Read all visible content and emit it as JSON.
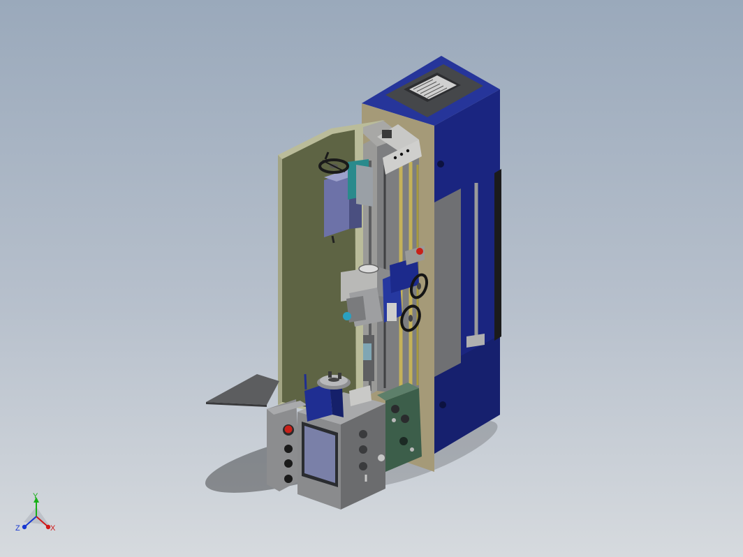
{
  "viewport": {
    "background_top": "#9aa9bb",
    "background_bottom": "#d6dade"
  },
  "model": {
    "accent_blue": "#1c2a8c",
    "panel_olive": "#5e6444",
    "frame_tan": "#a59a78",
    "rail_yellow": "#c4b25a",
    "metal_gray": "#8a8c8e",
    "status_red": "#c82018"
  },
  "triad": {
    "x_label": "X",
    "y_label": "Y",
    "z_label": "Z",
    "x_color": "#d01818",
    "y_color": "#18b018",
    "z_color": "#1838d0"
  }
}
